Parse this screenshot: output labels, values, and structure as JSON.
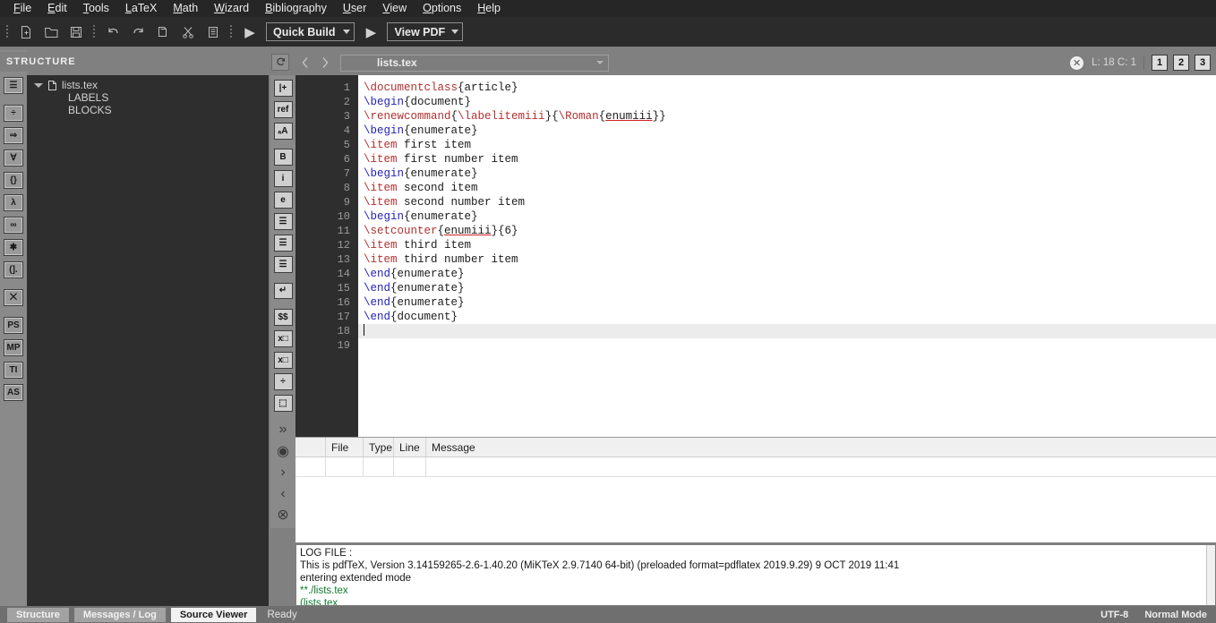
{
  "menubar": {
    "items": [
      {
        "label": "File",
        "accel": "F"
      },
      {
        "label": "Edit",
        "accel": "E"
      },
      {
        "label": "Tools",
        "accel": "T"
      },
      {
        "label": "LaTeX",
        "accel": "L"
      },
      {
        "label": "Math",
        "accel": "M"
      },
      {
        "label": "Wizard",
        "accel": "W"
      },
      {
        "label": "Bibliography",
        "accel": "B"
      },
      {
        "label": "User",
        "accel": "U"
      },
      {
        "label": "View",
        "accel": "V"
      },
      {
        "label": "Options",
        "accel": "O"
      },
      {
        "label": "Help",
        "accel": "H"
      }
    ]
  },
  "toolbar": {
    "buttons": [
      {
        "name": "new-file-icon"
      },
      {
        "name": "open-folder-icon"
      },
      {
        "name": "save-icon"
      },
      {
        "name": "undo-icon"
      },
      {
        "name": "redo-icon"
      },
      {
        "name": "copy-icon"
      },
      {
        "name": "cut-icon"
      },
      {
        "name": "paste-icon"
      }
    ],
    "build_run_label": "▶",
    "quick_build": "Quick Build",
    "view_run_label": "▶",
    "view_pdf": "View PDF"
  },
  "left_rail": {
    "items": [
      {
        "name": "list-icon",
        "glyph": "☰"
      },
      {
        "name": "division-icon",
        "glyph": "÷"
      },
      {
        "name": "implies-arrow-icon",
        "glyph": "⇒"
      },
      {
        "name": "forall-icon",
        "glyph": "∀"
      },
      {
        "name": "braces-icon",
        "glyph": "{}"
      },
      {
        "name": "lambda-icon",
        "glyph": "λ"
      },
      {
        "name": "infinity-icon",
        "glyph": "∞"
      },
      {
        "name": "asterisk-icon",
        "glyph": "✱"
      },
      {
        "name": "brackets-dot-icon",
        "glyph": "(]."
      },
      {
        "name": "dagger-x-icon",
        "glyph": "⨉"
      },
      {
        "name": "ps-icon",
        "glyph": "PS"
      },
      {
        "name": "mp-icon",
        "glyph": "MP"
      },
      {
        "name": "ti-icon",
        "glyph": "TI"
      },
      {
        "name": "as-icon",
        "glyph": "AS"
      }
    ]
  },
  "structure": {
    "title": "STRUCTURE",
    "refresh_icon": "refresh-icon",
    "root": "lists.tex",
    "children": [
      "LABELS",
      "BLOCKS"
    ]
  },
  "editor_topbar": {
    "prev_icon": "chevron-left-icon",
    "next_icon": "chevron-right-icon",
    "filename": "lists.tex",
    "close_glyph": "✕",
    "position": "L: 18 C: 1",
    "view_buttons": [
      "1",
      "2",
      "3"
    ]
  },
  "editor_rail": {
    "items": [
      {
        "name": "insert-label-icon",
        "glyph": "|+"
      },
      {
        "name": "ref-icon",
        "glyph": "ref"
      },
      {
        "name": "font-size-icon",
        "glyph": "ₐA"
      },
      {
        "name": "bold-icon",
        "glyph": "B"
      },
      {
        "name": "italic-icon",
        "glyph": "i"
      },
      {
        "name": "emphasis-icon",
        "glyph": "e"
      },
      {
        "name": "align-left-icon",
        "glyph": "☰"
      },
      {
        "name": "align-center-icon",
        "glyph": "☰"
      },
      {
        "name": "align-right-icon",
        "glyph": "☰"
      },
      {
        "name": "newline-icon",
        "glyph": "↵"
      },
      {
        "name": "math-mode-icon",
        "glyph": "$$"
      },
      {
        "name": "subscript-icon",
        "glyph": "x□"
      },
      {
        "name": "superscript-icon",
        "glyph": "x□"
      },
      {
        "name": "fraction-icon",
        "glyph": "÷"
      },
      {
        "name": "binom-icon",
        "glyph": "⬚"
      },
      {
        "name": "more-chevrons-icon",
        "glyph": "»"
      },
      {
        "name": "preview-eye-icon",
        "glyph": "◉"
      },
      {
        "name": "forward-chevron-icon",
        "glyph": "›"
      },
      {
        "name": "back-chevron-icon",
        "glyph": "‹"
      },
      {
        "name": "cancel-circle-icon",
        "glyph": "⊗"
      }
    ]
  },
  "code": {
    "line_numbers": [
      "1",
      "2",
      "3",
      "4",
      "5",
      "6",
      "7",
      "8",
      "9",
      "10",
      "11",
      "12",
      "13",
      "14",
      "15",
      "16",
      "17",
      "18",
      "19"
    ],
    "active_line": 18,
    "lines": [
      {
        "n": 1,
        "tokens": [
          {
            "t": "\\documentclass",
            "c": "cmd"
          },
          {
            "t": "{article}",
            "c": "plain"
          }
        ]
      },
      {
        "n": 2,
        "tokens": [
          {
            "t": "\\begin",
            "c": "env"
          },
          {
            "t": "{document}",
            "c": "plain"
          }
        ]
      },
      {
        "n": 3,
        "tokens": [
          {
            "t": "\\renewcommand",
            "c": "cmd"
          },
          {
            "t": "{",
            "c": "plain"
          },
          {
            "t": "\\labelitemiii",
            "c": "cmd"
          },
          {
            "t": "}{",
            "c": "plain"
          },
          {
            "t": "\\Roman",
            "c": "cmd"
          },
          {
            "t": "{",
            "c": "plain"
          },
          {
            "t": "enumiii",
            "c": "err"
          },
          {
            "t": "}}",
            "c": "plain"
          }
        ]
      },
      {
        "n": 4,
        "tokens": [
          {
            "t": "\\begin",
            "c": "env"
          },
          {
            "t": "{enumerate}",
            "c": "plain"
          }
        ]
      },
      {
        "n": 5,
        "tokens": [
          {
            "t": "\\item",
            "c": "cmd"
          },
          {
            "t": " first item",
            "c": "plain"
          }
        ]
      },
      {
        "n": 6,
        "tokens": [
          {
            "t": "\\item",
            "c": "cmd"
          },
          {
            "t": " first number item",
            "c": "plain"
          }
        ]
      },
      {
        "n": 7,
        "tokens": [
          {
            "t": "\\begin",
            "c": "env"
          },
          {
            "t": "{enumerate}",
            "c": "plain"
          }
        ]
      },
      {
        "n": 8,
        "tokens": [
          {
            "t": "\\item",
            "c": "cmd"
          },
          {
            "t": " second item",
            "c": "plain"
          }
        ]
      },
      {
        "n": 9,
        "tokens": [
          {
            "t": "\\item",
            "c": "cmd"
          },
          {
            "t": " second number item",
            "c": "plain"
          }
        ]
      },
      {
        "n": 10,
        "tokens": [
          {
            "t": "\\begin",
            "c": "env"
          },
          {
            "t": "{enumerate}",
            "c": "plain"
          }
        ]
      },
      {
        "n": 11,
        "tokens": [
          {
            "t": "\\setcounter",
            "c": "cmd"
          },
          {
            "t": "{",
            "c": "plain"
          },
          {
            "t": "enumiii",
            "c": "err"
          },
          {
            "t": "}{6}",
            "c": "plain"
          }
        ]
      },
      {
        "n": 12,
        "tokens": [
          {
            "t": "\\item",
            "c": "cmd"
          },
          {
            "t": " third item",
            "c": "plain"
          }
        ]
      },
      {
        "n": 13,
        "tokens": [
          {
            "t": "\\item",
            "c": "cmd"
          },
          {
            "t": " third number item",
            "c": "plain"
          }
        ]
      },
      {
        "n": 14,
        "tokens": [
          {
            "t": "\\end",
            "c": "env"
          },
          {
            "t": "{enumerate}",
            "c": "plain"
          }
        ]
      },
      {
        "n": 15,
        "tokens": [
          {
            "t": "\\end",
            "c": "env"
          },
          {
            "t": "{enumerate}",
            "c": "plain"
          }
        ]
      },
      {
        "n": 16,
        "tokens": [
          {
            "t": "\\end",
            "c": "env"
          },
          {
            "t": "{enumerate}",
            "c": "plain"
          }
        ]
      },
      {
        "n": 17,
        "tokens": [
          {
            "t": "\\end",
            "c": "env"
          },
          {
            "t": "{document}",
            "c": "plain"
          }
        ]
      },
      {
        "n": 18,
        "tokens": []
      },
      {
        "n": 19,
        "tokens": []
      }
    ]
  },
  "messages": {
    "columns": [
      "",
      "File",
      "Type",
      "Line",
      "Message"
    ],
    "rows": []
  },
  "log": {
    "lines": [
      {
        "text": "LOG FILE :",
        "green": false
      },
      {
        "text": "This is pdfTeX, Version 3.14159265-2.6-1.40.20 (MiKTeX 2.9.7140 64-bit) (preloaded format=pdflatex 2019.9.29) 9 OCT 2019 11:41",
        "green": false
      },
      {
        "text": "entering extended mode",
        "green": false
      },
      {
        "text": "**./lists.tex",
        "green": true
      },
      {
        "text": "(lists.tex",
        "green": true
      }
    ]
  },
  "statusbar": {
    "tabs": [
      {
        "label": "Structure",
        "selected": false
      },
      {
        "label": "Messages / Log",
        "selected": false
      },
      {
        "label": "Source Viewer",
        "selected": true
      }
    ],
    "ready": "Ready",
    "encoding": "UTF-8",
    "mode": "Normal Mode"
  },
  "colors": {
    "menubar_bg": "#262626",
    "toolbar_bg": "#2b2b2b",
    "panel_bg": "#808080",
    "tree_bg": "#2e2e2e",
    "editor_bg": "#ffffff",
    "cmd_red": "#b03030",
    "env_blue": "#2222bb",
    "log_green": "#0d7a2c",
    "error_underline": "#d02020"
  }
}
